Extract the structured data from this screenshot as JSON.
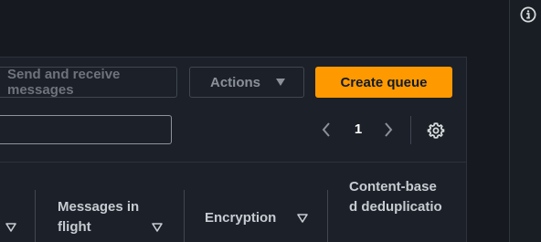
{
  "help_rail": {
    "info_icon": "info-icon"
  },
  "toolbar": {
    "send_receive_label": "Send and receive messages",
    "actions_label": "Actions",
    "create_label": "Create queue",
    "accent_color": "#ff9900"
  },
  "search": {
    "value": "",
    "placeholder": ""
  },
  "pagination": {
    "current_page": "1",
    "prev_icon": "chevron-left-icon",
    "next_icon": "chevron-right-icon",
    "settings_icon": "gear-icon"
  },
  "table": {
    "columns": [
      {
        "label": "",
        "sortable": true
      },
      {
        "label": "Messages in flight",
        "sortable": true
      },
      {
        "label": "Encryption",
        "sortable": true
      },
      {
        "label": "Content-based deduplicatio",
        "sortable": false
      }
    ]
  }
}
